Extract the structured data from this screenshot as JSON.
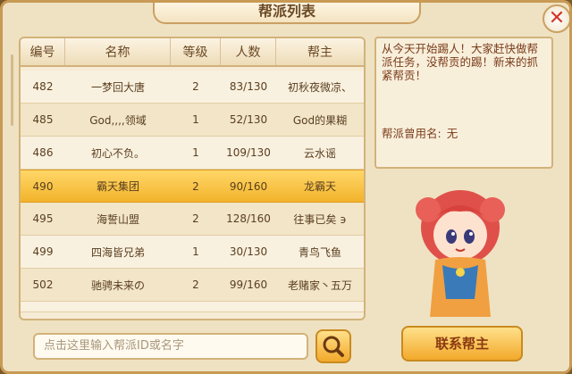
{
  "title": "帮派列表",
  "close_icon": "close-icon",
  "table": {
    "headers": [
      "编号",
      "名称",
      "等级",
      "人数",
      "帮主"
    ],
    "rows": [
      {
        "id": "482",
        "name": "一梦回大唐",
        "level": "2",
        "members": "83/130",
        "leader": "初秋夜微凉、"
      },
      {
        "id": "485",
        "name": "God,,,,领域",
        "level": "1",
        "members": "52/130",
        "leader": "God的果糊"
      },
      {
        "id": "486",
        "name": "初心不负。",
        "level": "1",
        "members": "109/130",
        "leader": "云水谣"
      },
      {
        "id": "490",
        "name": "霸天集团",
        "level": "2",
        "members": "90/160",
        "leader": "龙霸天"
      },
      {
        "id": "495",
        "name": "海誓山盟",
        "level": "2",
        "members": "128/160",
        "leader": "往事已矣 ϶"
      },
      {
        "id": "499",
        "name": "四海皆兄弟",
        "level": "1",
        "members": "30/130",
        "leader": "青鸟飞鱼"
      },
      {
        "id": "502",
        "name": "驰骋未来の",
        "level": "2",
        "members": "99/160",
        "leader": "老赌家丶五万"
      }
    ],
    "selected_index": 3
  },
  "notice": {
    "text": "从今天开始踢人！大家赶快做帮派任务，没帮贡的踢！新来的抓紧帮贡！",
    "former_name_label": "帮派曾用名:",
    "former_name_value": "无"
  },
  "search": {
    "placeholder": "点击这里输入帮派ID或名字",
    "icon": "magnifier-icon"
  },
  "contact_button": "联系帮主",
  "colors": {
    "panel_bg": "#efe2c2",
    "border": "#c89a55",
    "selected_row": "#f2b32b",
    "text": "#5a3e20",
    "close_red": "#d2382a"
  }
}
